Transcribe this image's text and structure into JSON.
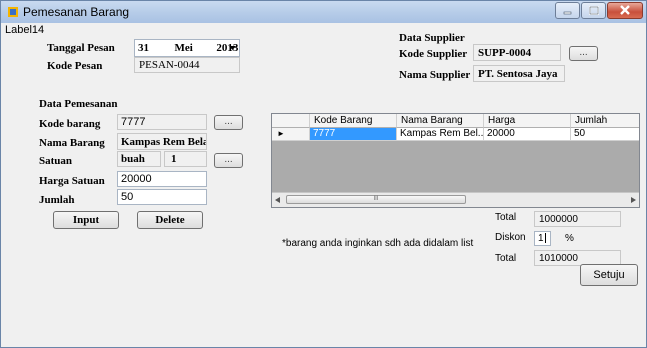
{
  "window": {
    "title": "Pemesanan Barang",
    "label": "Label14"
  },
  "header": {
    "tanggal_label": "Tanggal Pesan",
    "date_day": "31",
    "date_month": "Mei",
    "date_year": "2013",
    "kode_pesan_label": "Kode Pesan",
    "kode_pesan_value": "PESAN-0044"
  },
  "supplier": {
    "group_label": "Data Supplier",
    "kode_label": "Kode Supplier",
    "kode_value": "SUPP-0004",
    "nama_label": "Nama Supplier",
    "nama_value": "PT. Sentosa Jaya",
    "browse_label": "..."
  },
  "order": {
    "group_label": "Data Pemesanan",
    "kode_barang_label": "Kode barang",
    "kode_barang_value": "7777",
    "nama_barang_label": "Nama Barang",
    "nama_barang_value": "Kampas Rem Bela",
    "satuan_label": "Satuan",
    "satuan_value": "buah",
    "satuan_qty": "1",
    "harga_label": "Harga Satuan",
    "harga_value": "20000",
    "jumlah_label": "Jumlah",
    "jumlah_value": "50",
    "browse_label": "...",
    "input_button": "Input",
    "delete_button": "Delete"
  },
  "grid": {
    "columns": [
      "Kode Barang",
      "Nama Barang",
      "Harga",
      "Jumlah"
    ],
    "rows": [
      {
        "indicator": "►",
        "kode": "7777",
        "nama": "Kampas Rem Bel...",
        "harga": "20000",
        "jumlah": "50"
      }
    ],
    "scroll_thumb_glyph": "III"
  },
  "totals": {
    "total_label": "Total",
    "total_value": "1000000",
    "diskon_label": "Diskon",
    "diskon_value": "1",
    "percent": "%",
    "grand_total_label": "Total",
    "grand_total_value": "1010000",
    "note": "*barang anda inginkan sdh ada didalam list",
    "setuju_button": "Setuju"
  }
}
